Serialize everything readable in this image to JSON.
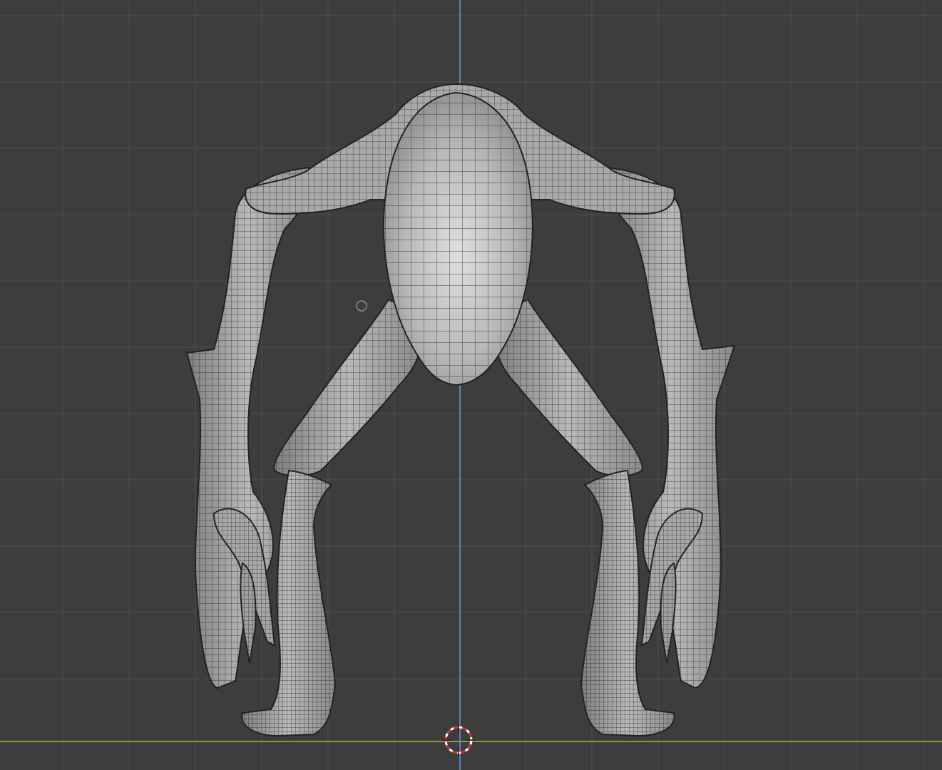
{
  "viewport": {
    "background": "#3d3d3d",
    "grid_color": "#4a4a4a",
    "z_axis_color": "#5580c0",
    "x_axis_color": "#8a9a3a",
    "mesh_fill": "#9a9a9a",
    "mesh_light": "#cdcdcd",
    "mesh_wire": "#2a2a2a"
  },
  "scene": {
    "object": "creature-mesh",
    "display": "wireframe-overlay",
    "cursor_icon": "3d-cursor-icon",
    "origin_icon": "object-origin-icon"
  }
}
